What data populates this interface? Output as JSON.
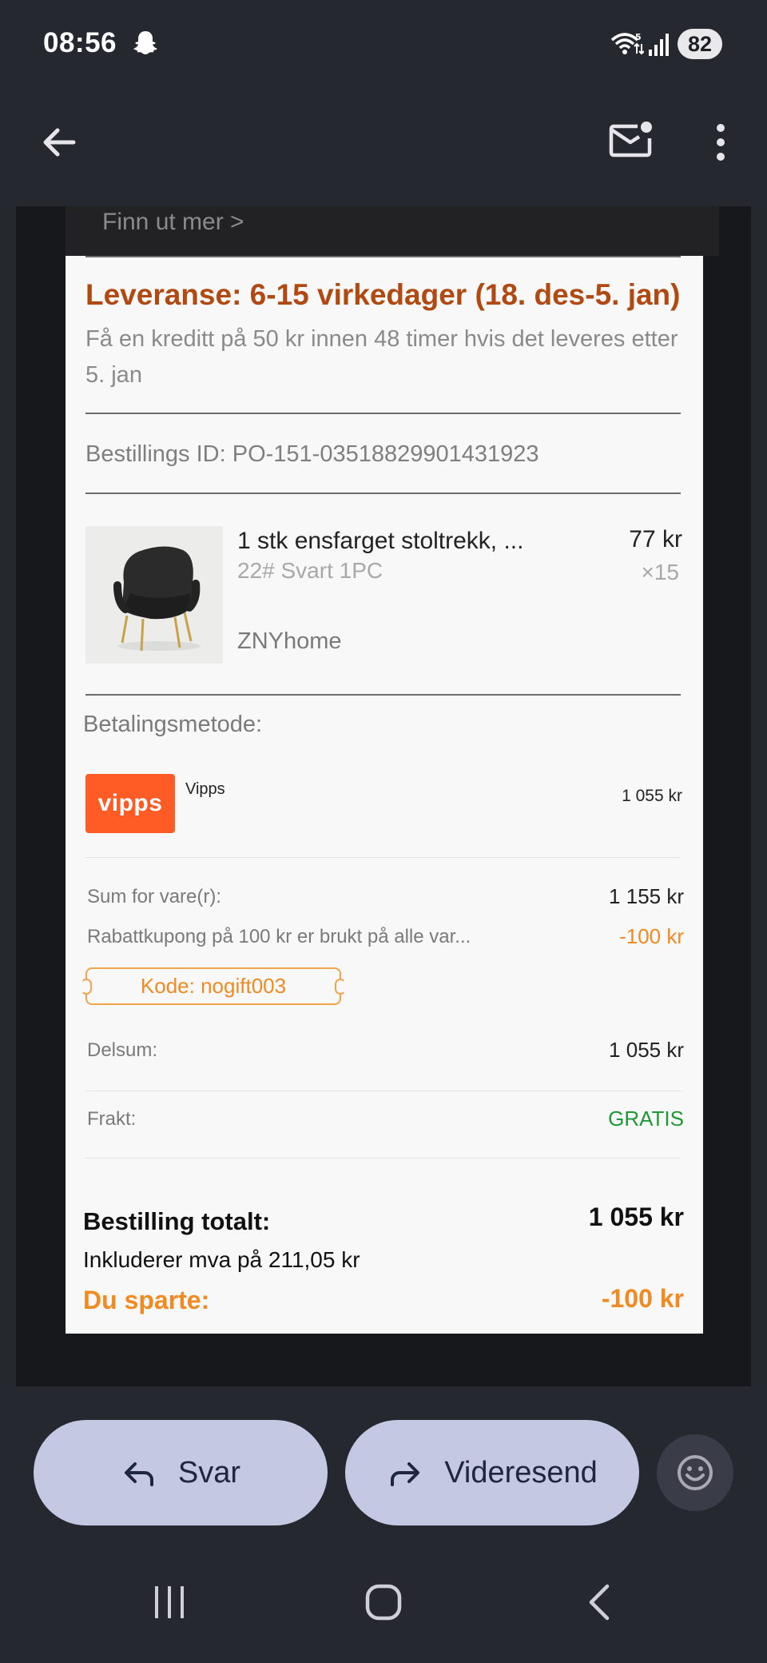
{
  "status_bar": {
    "time": "08:56",
    "battery": "82"
  },
  "icons": {
    "ghost": "snapchat-ghost-icon",
    "wifi": "wifi-icon",
    "signal": "signal-icon",
    "back": "back-arrow-icon",
    "mail": "mark-unread-icon",
    "more": "more-vertical-icon"
  },
  "email": {
    "promo_link": "Finn ut mer >",
    "delivery_title": "Leveranse: 6-15 virkedager (18. des-5. jan)",
    "delivery_note": "Få en kreditt på 50 kr innen 48 timer hvis det leveres etter 5. jan",
    "order_id": "Bestillings ID: PO-151-03518829901431923",
    "product": {
      "title": "1 stk ensfarget stoltrekk, ...",
      "variant": "22# Svart 1PC",
      "seller": "ZNYhome",
      "price": "77 kr",
      "quantity": "×15"
    },
    "payment": {
      "heading": "Betalingsmetode:",
      "logo_text": "vipps",
      "method": "Vipps",
      "amount": "1 055 kr"
    },
    "summary": {
      "items_label": "Sum for vare(r):",
      "items_value": "1 155 kr",
      "coupon_label": "Rabattkupong på 100 kr er brukt på alle var...",
      "coupon_value": "-100 kr",
      "coupon_code": "Kode: nogift003",
      "subtotal_label": "Delsum:",
      "subtotal_value": "1 055 kr",
      "shipping_label": "Frakt:",
      "shipping_value": "GRATIS",
      "total_label": "Bestilling totalt:",
      "total_value": "1 055 kr",
      "vat_note": "Inkluderer mva på 211,05 kr",
      "saved_label": "Du sparte:",
      "saved_value": "-100 kr"
    }
  },
  "actions": {
    "reply": "Svar",
    "forward": "Videresend"
  },
  "colors": {
    "background": "#262830",
    "delivery_title": "#b04a12",
    "accent_orange": "#f08a21",
    "vipps_orange": "#ff5b24",
    "free_green": "#1e9a34",
    "pill": "#c4c8e2"
  }
}
